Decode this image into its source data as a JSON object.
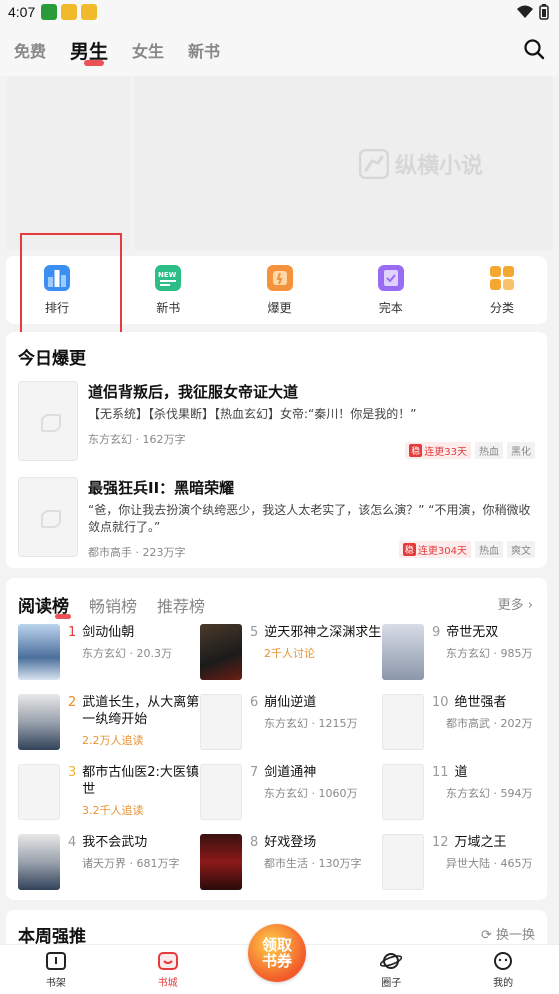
{
  "status": {
    "time": "4:07"
  },
  "topnav": {
    "tabs": [
      "免费",
      "男生",
      "女生",
      "新书"
    ],
    "active": "男生"
  },
  "banner": {
    "logo_text": "纵横小说"
  },
  "quick": [
    {
      "label": "排行",
      "icon": "ranking-icon",
      "color": "#3b8ff0"
    },
    {
      "label": "新书",
      "icon": "new-book-icon",
      "color": "#2dbd86"
    },
    {
      "label": "爆更",
      "icon": "burst-update-icon",
      "color": "#f5923e"
    },
    {
      "label": "完本",
      "icon": "complete-book-icon",
      "color": "#9a6cf2"
    },
    {
      "label": "分类",
      "icon": "category-icon",
      "color": "#f5a82f"
    }
  ],
  "today": {
    "title": "今日爆更",
    "books": [
      {
        "title": "道侣背叛后，我征服女帝证大道",
        "desc": "【无系统】【杀伐果断】【热血玄幻】女帝:“秦川！你是我的！”",
        "meta": "东方玄幻 · 162万字",
        "wen": "稳",
        "streak": "连更33天",
        "tags": [
          "热血",
          "黑化"
        ]
      },
      {
        "title": "最强狂兵II：黑暗荣耀",
        "desc": "“爸，你让我去扮演个纨绔恶少，我这人太老实了，该怎么演？” “不用演，你稍微收敛点就行了。”",
        "meta": "都市高手 · 223万字",
        "wen": "稳",
        "streak": "连更304天",
        "tags": [
          "热血",
          "爽文"
        ]
      }
    ]
  },
  "rank": {
    "tabs": [
      "阅读榜",
      "畅销榜",
      "推荐榜"
    ],
    "more": "更多",
    "items": [
      {
        "n": "1",
        "title": "剑动仙朝",
        "sub": "东方玄幻 · 20.3万",
        "cover": "blue"
      },
      {
        "n": "5",
        "title": "逆天邪神之深渊求生",
        "sub": "2千人讨论",
        "cover": "dark",
        "orange": true
      },
      {
        "n": "9",
        "title": "帝世无双",
        "sub": "东方玄幻 · 985万",
        "cover": "gray"
      },
      {
        "n": "2",
        "title": "武道长生，从大离第一纨绔开始",
        "sub": "2.2万人追读",
        "cover": "ink",
        "orange": true
      },
      {
        "n": "6",
        "title": "崩仙逆道",
        "sub": "东方玄幻 · 1215万",
        "cover": ""
      },
      {
        "n": "10",
        "title": "绝世强者",
        "sub": "都市高武 · 202万",
        "cover": ""
      },
      {
        "n": "3",
        "title": "都市古仙医2:大医镇世",
        "sub": "3.2千人追读",
        "cover": "",
        "orange": true
      },
      {
        "n": "7",
        "title": "剑道通神",
        "sub": "东方玄幻 · 1060万",
        "cover": ""
      },
      {
        "n": "11",
        "title": "道",
        "sub": "东方玄幻 · 594万",
        "cover": ""
      },
      {
        "n": "4",
        "title": "我不会武功",
        "sub": "诸天万界 · 681万字",
        "cover": "ink"
      },
      {
        "n": "8",
        "title": "好戏登场",
        "sub": "都市生活 · 130万字",
        "cover": "red"
      },
      {
        "n": "12",
        "title": "万域之王",
        "sub": "异世大陆 · 465万",
        "cover": ""
      }
    ]
  },
  "weekly": {
    "title": "本周强推",
    "swap": "换一换"
  },
  "promo": {
    "line1": "领取",
    "line2": "书券"
  },
  "bottom": [
    {
      "label": "书架",
      "icon": "bookshelf-icon"
    },
    {
      "label": "书城",
      "icon": "bookstore-icon",
      "active": true
    },
    {
      "label": "",
      "icon": ""
    },
    {
      "label": "圈子",
      "icon": "planet-icon"
    },
    {
      "label": "我的",
      "icon": "profile-icon"
    }
  ]
}
